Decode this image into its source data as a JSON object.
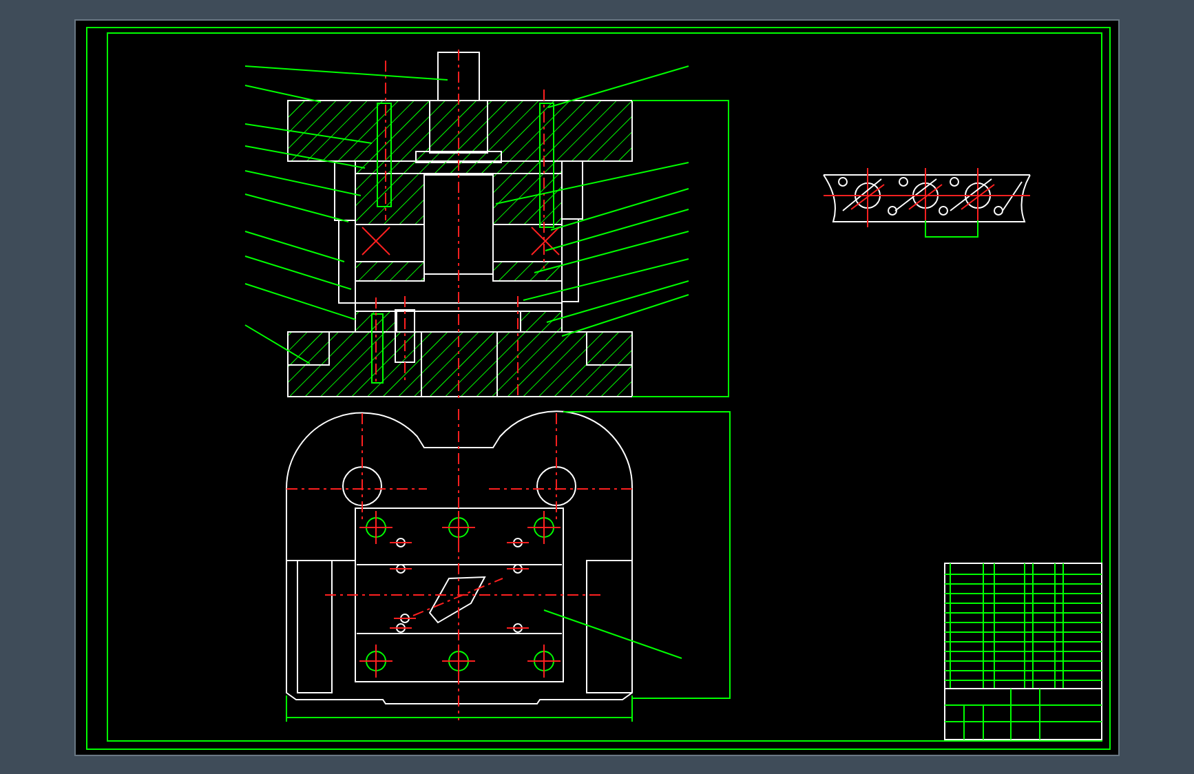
{
  "viewport": {
    "kind": "die-assembly-drawing"
  }
}
